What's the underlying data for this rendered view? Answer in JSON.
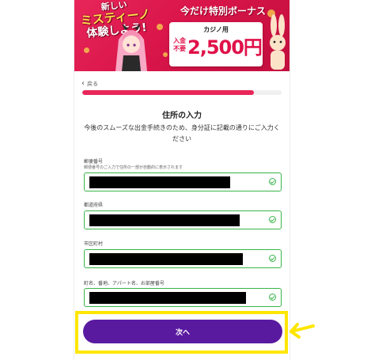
{
  "banner": {
    "promo_line1": "新しい",
    "promo_line2": "ミスティーノ",
    "promo_line3": "体験しよう!",
    "bonus_title": "今だけ特別ボーナス",
    "prize_caption": "カジノ用",
    "prize_small_line1": "入金",
    "prize_small_line2": "不要",
    "prize_amount": "2,500円",
    "accent_color": "#e8265a"
  },
  "nav": {
    "back_label": "戻る",
    "progress": 0.86
  },
  "form": {
    "heading": "住所の入力",
    "description": "今後のスムーズな出金手続きのため、身分証に記載の通りにご入力ください",
    "fields": [
      {
        "label": "郵便番号",
        "hint": "郵便番号のご入力で住所の一部が自動的に表示されます"
      },
      {
        "label": "都道府県"
      },
      {
        "label": "市区町村"
      },
      {
        "label": "町名、番地、アパート名、お部屋番号"
      }
    ]
  },
  "actions": {
    "next_label": "次へ",
    "button_color": "#5a1aa0",
    "highlight_color": "#ffe600"
  }
}
